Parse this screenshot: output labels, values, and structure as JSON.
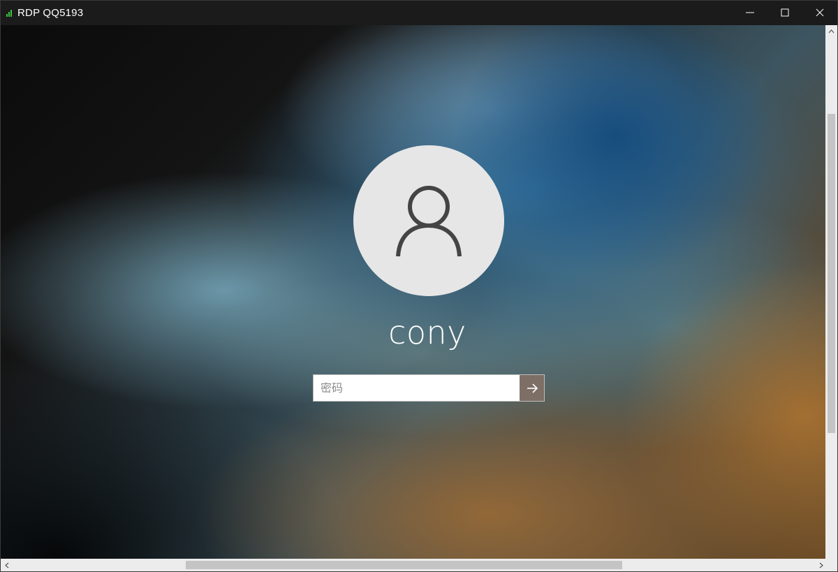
{
  "window": {
    "title": "RDP QQ5193",
    "signal_color": "#3cc43c",
    "controls": [
      "minimize",
      "maximize",
      "close"
    ]
  },
  "login": {
    "username": "cony",
    "password_placeholder": "密码",
    "password_value": "",
    "submit_icon": "arrow-right-icon",
    "avatar_icon": "user-icon"
  },
  "colors": {
    "titlebar": "#1b1b1b",
    "avatar_bg": "#e6e6e6",
    "submit_bg": "#7d6f66",
    "scrollbar_track": "#ececec",
    "scrollbar_thumb": "#c4c4c4"
  },
  "scrollbars": {
    "vertical": true,
    "horizontal": true
  }
}
